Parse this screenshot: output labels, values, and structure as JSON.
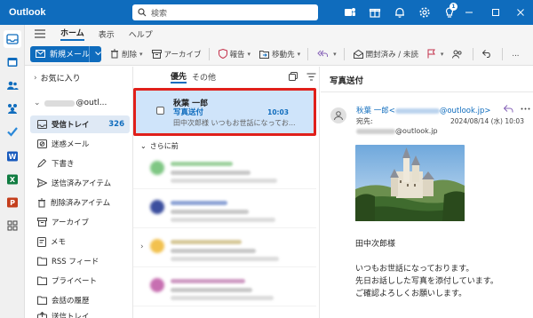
{
  "app": {
    "title": "Outlook"
  },
  "search": {
    "placeholder": "検索"
  },
  "notifications": {
    "count": "1"
  },
  "ribbon": {
    "tabs": [
      "ホーム",
      "表示",
      "ヘルプ"
    ]
  },
  "toolbar": {
    "new_mail": "新規メール",
    "delete": "削除",
    "archive": "アーカイブ",
    "report": "報告",
    "move": "移動先",
    "read_unread": "開封済み / 未読",
    "more": "..."
  },
  "folders": {
    "favorites": "お気に入り",
    "account_suffix": "@outl...",
    "items": [
      {
        "label": "受信トレイ",
        "count": "326"
      },
      {
        "label": "迷惑メール"
      },
      {
        "label": "下書き"
      },
      {
        "label": "送信済みアイテム"
      },
      {
        "label": "削除済みアイテム"
      },
      {
        "label": "アーカイブ"
      },
      {
        "label": "メモ"
      },
      {
        "label": "RSS フィード"
      },
      {
        "label": "プライベート"
      },
      {
        "label": "会話の履歴"
      },
      {
        "label": "送信トレイ"
      }
    ]
  },
  "msglist": {
    "filters": [
      "優先",
      "その他"
    ],
    "selected": {
      "sender": "秋葉 一郎",
      "subject": "写真送付",
      "time": "10:03",
      "preview": "田中次郎様 いつもお世話になってお..."
    },
    "earlier_label": "さらに前"
  },
  "reading": {
    "subject": "写真送付",
    "from_name": "秋葉 一郎<",
    "from_domain": "@outlook.jp>",
    "to_label": "宛先:",
    "to_domain": "@outlook.jp",
    "date": "2024/08/14 (水) 10:03",
    "body": [
      "田中次郎様",
      "いつもお世話になっております。",
      "先日お話しした写真を添付しています。",
      "ご確認よろしくお願いします。"
    ]
  }
}
